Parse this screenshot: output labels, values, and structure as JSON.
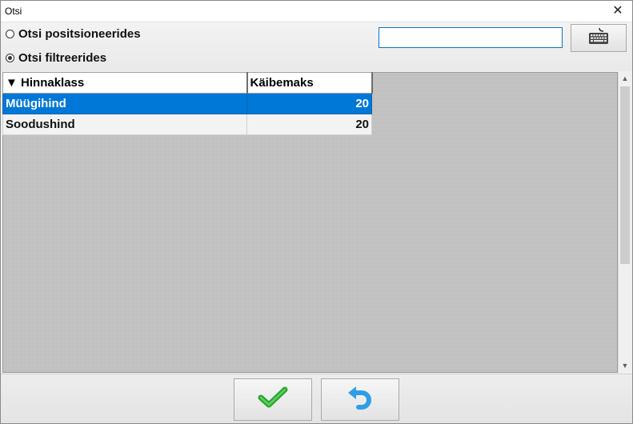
{
  "window": {
    "title": "Otsi"
  },
  "search": {
    "options": [
      {
        "label": "Otsi positsioneerides",
        "checked": false
      },
      {
        "label": "Otsi filtreerides",
        "checked": true
      }
    ],
    "input_value": "",
    "keyboard_icon": "keyboard-icon"
  },
  "table": {
    "columns": [
      {
        "label": "Hinnaklass",
        "sort_indicator": "▼"
      },
      {
        "label": "Käibemaks"
      }
    ],
    "rows": [
      {
        "name": "Müügihind",
        "vat": "20",
        "selected": true
      },
      {
        "name": "Soodushind",
        "vat": "20",
        "selected": false
      }
    ]
  },
  "actions": {
    "ok_icon": "checkmark-icon",
    "back_icon": "undo-arrow-icon"
  },
  "colors": {
    "selection": "#0078d7",
    "ok_green": "#2aa52e",
    "back_blue": "#2f9ee6"
  }
}
